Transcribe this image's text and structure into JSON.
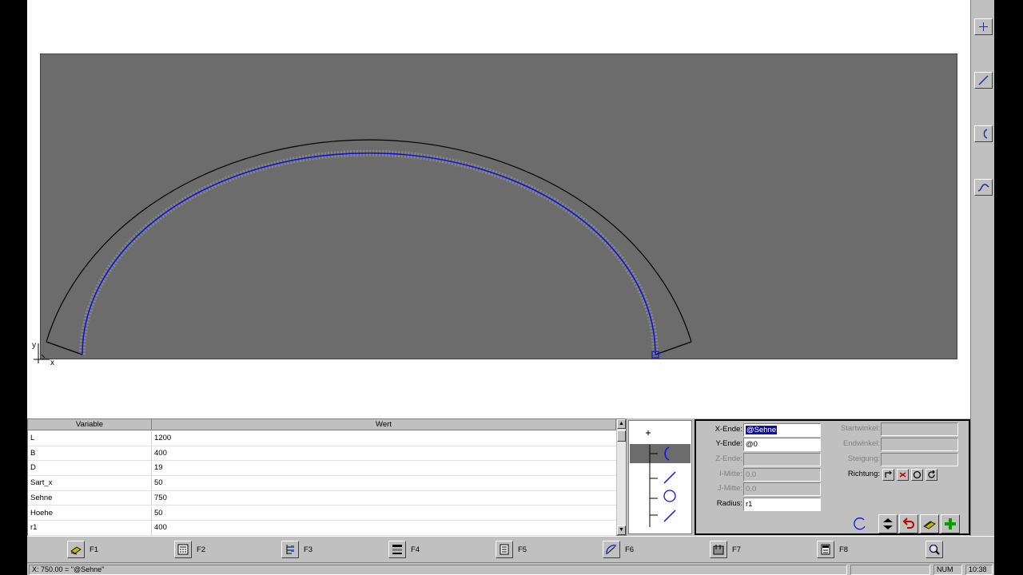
{
  "origin_labels": {
    "y": "y",
    "x": "x"
  },
  "variable_table": {
    "headers": {
      "variable": "Variable",
      "value": "Wert"
    },
    "rows": [
      {
        "name": "L",
        "value": "1200"
      },
      {
        "name": "B",
        "value": "400"
      },
      {
        "name": "D",
        "value": "19"
      },
      {
        "name": "Sart_x",
        "value": "50"
      },
      {
        "name": "Sehne",
        "value": "750"
      },
      {
        "name": "Hoehe",
        "value": "50"
      },
      {
        "name": "r1",
        "value": "400"
      }
    ]
  },
  "params": {
    "x_ende": {
      "label": "X-Ende:",
      "value": "@Sehne"
    },
    "y_ende": {
      "label": "Y-Ende:",
      "value": "@0"
    },
    "z_ende": {
      "label": "Z-Ende:",
      "value": ""
    },
    "i_mitte": {
      "label": "I-Mitte:",
      "value": "0.0"
    },
    "j_mitte": {
      "label": "J-Mitte:",
      "value": "0.0"
    },
    "radius": {
      "label": "Radius:",
      "value": "r1"
    },
    "startwinkel": {
      "label": "Startwinkel:",
      "value": ""
    },
    "endwinkel": {
      "label": "Endwinkel:",
      "value": ""
    },
    "steigung": {
      "label": "Steigung:",
      "value": ""
    },
    "richtung": {
      "label": "Richtung:"
    }
  },
  "function_keys": [
    {
      "label": "F1",
      "icon": "book-icon"
    },
    {
      "label": "F2",
      "icon": "calculator-icon"
    },
    {
      "label": "F3",
      "icon": "tree-icon"
    },
    {
      "label": "F4",
      "icon": "list-icon"
    },
    {
      "label": "F5",
      "icon": "document-icon"
    },
    {
      "label": "F6",
      "icon": "tool-path-icon"
    },
    {
      "label": "F7",
      "icon": "machine-icon"
    },
    {
      "label": "F8",
      "icon": "nc-file-icon"
    }
  ],
  "statusbar": {
    "message": "X: 750.00 = \"@Sehne\"",
    "num": "NUM",
    "time": "10:38"
  },
  "colors": {
    "drawing_bg": "#6c6c6c",
    "contour": "#1010e0",
    "outline": "#000000"
  }
}
